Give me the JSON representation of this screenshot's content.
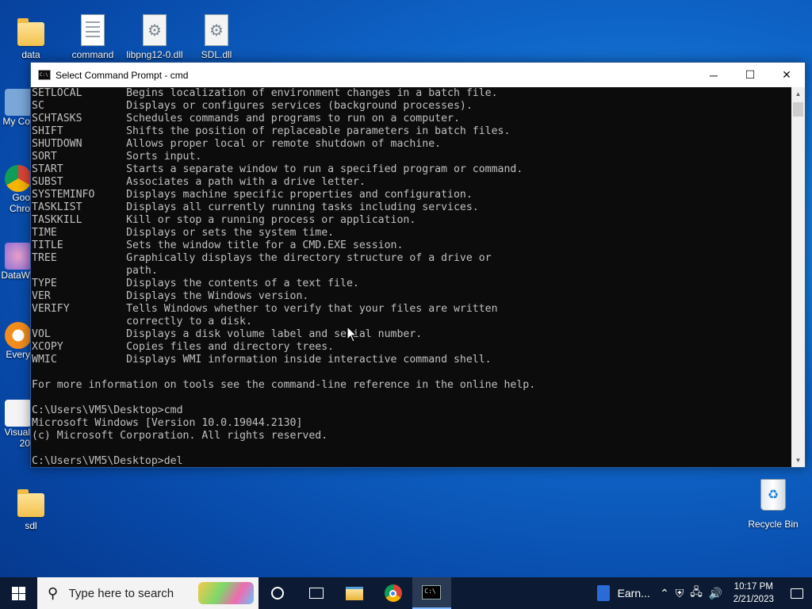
{
  "desktop": {
    "top_icons": [
      {
        "label": "data",
        "icon": "folder-icon"
      },
      {
        "label": "command",
        "icon": "text-document-icon"
      },
      {
        "label": "libpng12-0.dll",
        "icon": "dll-file-icon"
      },
      {
        "label": "SDL.dll",
        "icon": "dll-file-icon"
      }
    ],
    "partial_icons": [
      {
        "label": "My Co",
        "icon": "computer-icon"
      },
      {
        "label": "Goo",
        "label2": "Chro",
        "icon": "chrome-icon"
      },
      {
        "label": "DataW",
        "icon": "datawrapper-icon"
      },
      {
        "label": "Every",
        "icon": "everything-icon"
      },
      {
        "label": "Visual",
        "label2": "20",
        "icon": "visual-studio-icon"
      }
    ],
    "sdl_folder": {
      "label": "sdl",
      "icon": "folder-icon"
    },
    "recycle_bin": {
      "label": "Recycle Bin",
      "icon": "recycle-bin-icon"
    }
  },
  "window": {
    "title": "Select Command Prompt - cmd",
    "minimize": "─",
    "maximize": "☐",
    "close": "✕",
    "console_lines": [
      "SETLOCAL       Begins localization of environment changes in a batch file.",
      "SC             Displays or configures services (background processes).",
      "SCHTASKS       Schedules commands and programs to run on a computer.",
      "SHIFT          Shifts the position of replaceable parameters in batch files.",
      "SHUTDOWN       Allows proper local or remote shutdown of machine.",
      "SORT           Sorts input.",
      "START          Starts a separate window to run a specified program or command.",
      "SUBST          Associates a path with a drive letter.",
      "SYSTEMINFO     Displays machine specific properties and configuration.",
      "TASKLIST       Displays all currently running tasks including services.",
      "TASKKILL       Kill or stop a running process or application.",
      "TIME           Displays or sets the system time.",
      "TITLE          Sets the window title for a CMD.EXE session.",
      "TREE           Graphically displays the directory structure of a drive or",
      "               path.",
      "TYPE           Displays the contents of a text file.",
      "VER            Displays the Windows version.",
      "VERIFY         Tells Windows whether to verify that your files are written",
      "               correctly to a disk.",
      "VOL            Displays a disk volume label and serial number.",
      "XCOPY          Copies files and directory trees.",
      "WMIC           Displays WMI information inside interactive command shell.",
      "",
      "For more information on tools see the command-line reference in the online help.",
      "",
      "C:\\Users\\VM5\\Desktop>cmd",
      "Microsoft Windows [Version 10.0.19044.2130]",
      "(c) Microsoft Corporation. All rights reserved.",
      "",
      "C:\\Users\\VM5\\Desktop>del"
    ]
  },
  "taskbar": {
    "search_placeholder": "Type here to search",
    "earn_label": "Earn...",
    "tray_icons": [
      "chevron-up-icon",
      "security-icon",
      "network-icon",
      "volume-icon"
    ],
    "time": "10:17 PM",
    "date": "2/21/2023"
  }
}
